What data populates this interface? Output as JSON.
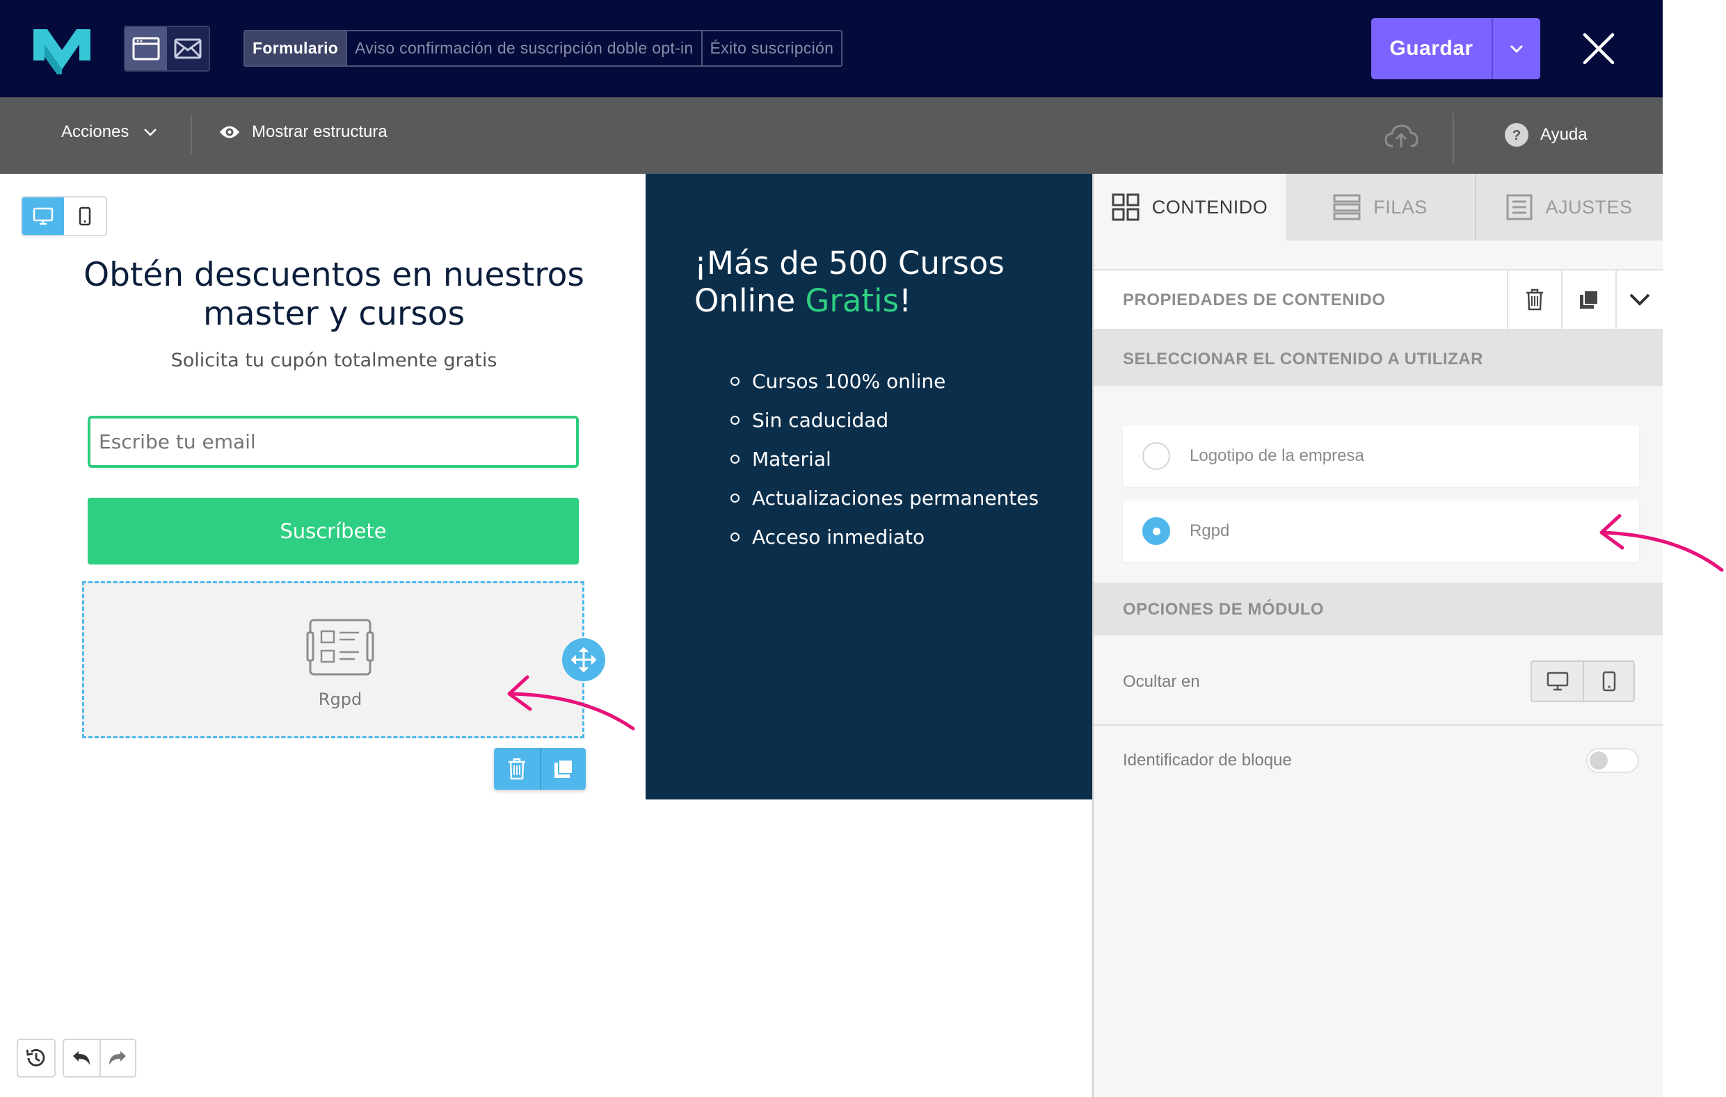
{
  "colors": {
    "topbar_bg": "#040a3a",
    "toolbar_bg": "#595a5c",
    "accent_purple": "#7a63ff",
    "accent_green": "#2ecf82",
    "accent_blue": "#4fb7eb",
    "promo_bg": "#0b2e4b",
    "annotation_pink": "#e8127a"
  },
  "header": {
    "tabs": [
      {
        "label": "Formulario",
        "active": true
      },
      {
        "label": "Aviso confirmación de suscripción doble opt-in",
        "active": false
      },
      {
        "label": "Éxito suscripción",
        "active": false
      }
    ],
    "save_label": "Guardar",
    "icons": {
      "logo": "brand-m-logo",
      "window": "browser-window-icon",
      "email": "envelope-icon",
      "close": "close-icon"
    }
  },
  "toolbar": {
    "acciones_label": "Acciones",
    "estructura_label": "Mostrar estructura",
    "ayuda_label": "Ayuda",
    "icons": {
      "chevron": "chevron-down-icon",
      "eye": "eye-icon",
      "cloud": "cloud-upload-icon",
      "help": "help-circle-icon"
    }
  },
  "form": {
    "title": "Obtén descuentos en nuestros master y cursos",
    "subtitle": "Solicita tu cupón totalmente gratis",
    "email_placeholder": "Escribe tu email",
    "button_label": "Suscríbete",
    "rgpd_label": "Rgpd"
  },
  "promo": {
    "title_before": "¡Más de 500 Cursos Online ",
    "title_highlight": "Gratis",
    "title_after": "!",
    "items": [
      "Cursos 100% online",
      "Sin caducidad",
      "Material",
      "Actualizaciones permanentes",
      "Acceso inmediato"
    ]
  },
  "panel": {
    "tabs": [
      {
        "label": "CONTENIDO",
        "active": true
      },
      {
        "label": "FILAS",
        "active": false
      },
      {
        "label": "AJUSTES",
        "active": false
      }
    ],
    "props_title": "PROPIEDADES DE CONTENIDO",
    "select_title": "SELECCIONAR EL CONTENIDO A UTILIZAR",
    "options": [
      {
        "label": "Logotipo de la empresa",
        "checked": false
      },
      {
        "label": "Rgpd",
        "checked": true
      }
    ],
    "module_title": "OPCIONES DE MÓDULO",
    "hide_label": "Ocultar en",
    "id_label": "Identificador de bloque",
    "id_toggle_on": false
  }
}
